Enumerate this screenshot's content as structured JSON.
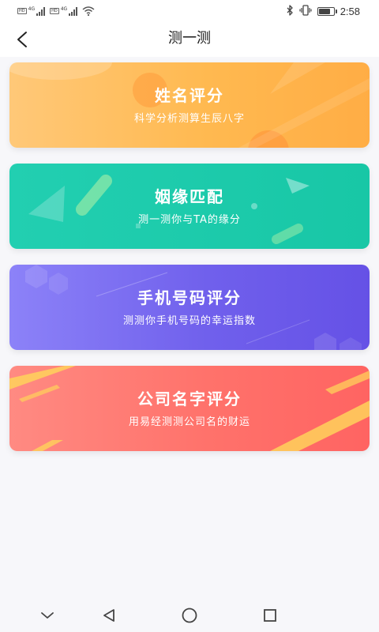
{
  "status_bar": {
    "sim1_tag": "HD",
    "sim1_net": "4G",
    "sim2_tag": "HD",
    "sim2_net": "4G",
    "battery_level": 0.7,
    "time": "2:58",
    "icons": [
      "signal-icon",
      "wifi-icon",
      "bluetooth-icon",
      "vibrate-icon",
      "battery-icon"
    ]
  },
  "header": {
    "title": "测一测",
    "back_icon": "back-arrow-icon"
  },
  "cards": [
    {
      "title": "姓名评分",
      "subtitle": "科学分析测算生辰八字",
      "color": "#ffbb55"
    },
    {
      "title": "姻缘匹配",
      "subtitle": "测一测你与TA的缘分",
      "color": "#1ec9aa"
    },
    {
      "title": "手机号码评分",
      "subtitle": "测测你手机号码的幸运指数",
      "color": "#7a6cf0"
    },
    {
      "title": "公司名字评分",
      "subtitle": "用易经测测公司名的财运",
      "color": "#ff6f69"
    }
  ],
  "nav_bar": {
    "icons": [
      "chevron-down-icon",
      "back-triangle-icon",
      "home-circle-icon",
      "recents-square-icon"
    ]
  }
}
